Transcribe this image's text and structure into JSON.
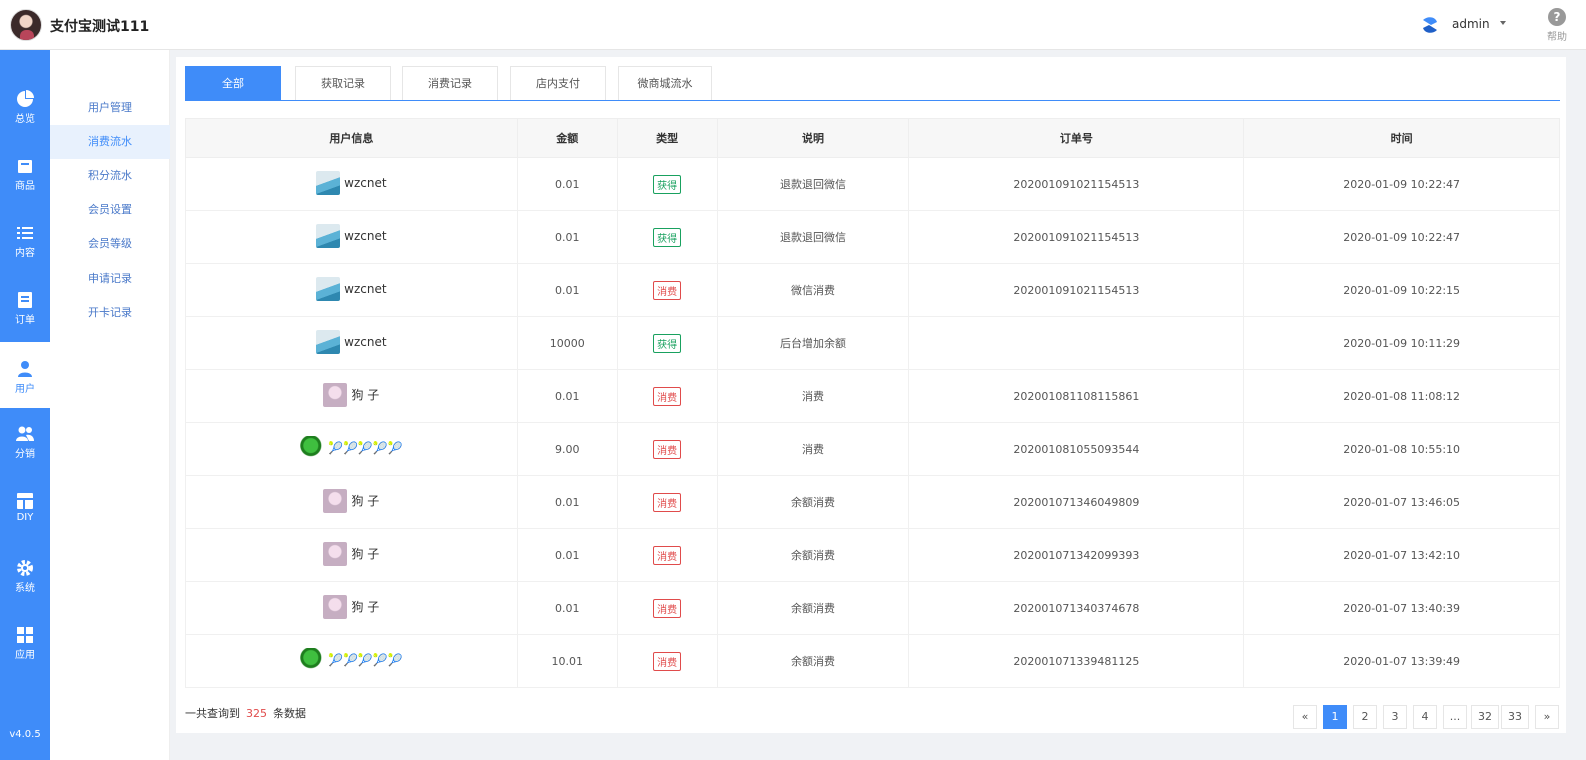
{
  "header": {
    "title": "支付宝测试111",
    "admin_name": "admin",
    "help_label": "帮助"
  },
  "nav": {
    "items": [
      {
        "label": "总览",
        "icon": "pie-chart-icon"
      },
      {
        "label": "商品",
        "icon": "shop-icon"
      },
      {
        "label": "内容",
        "icon": "list-icon"
      },
      {
        "label": "订单",
        "icon": "order-icon"
      },
      {
        "label": "用户",
        "icon": "user-icon"
      },
      {
        "label": "分销",
        "icon": "users-icon"
      },
      {
        "label": "DIY",
        "icon": "layout-icon"
      },
      {
        "label": "系统",
        "icon": "gear-icon"
      },
      {
        "label": "应用",
        "icon": "apps-icon"
      }
    ],
    "version": "v4.0.5"
  },
  "subnav": {
    "items": [
      "用户管理",
      "消费流水",
      "积分流水",
      "会员设置",
      "会员等级",
      "申请记录",
      "开卡记录"
    ]
  },
  "tabs": [
    "全部",
    "获取记录",
    "消费记录",
    "店内支付",
    "微商城流水"
  ],
  "table": {
    "headers": [
      "用户信息",
      "金额",
      "类型",
      "说明",
      "订单号",
      "时间"
    ],
    "rows": [
      {
        "user": "wzcnet",
        "amount": "0.01",
        "type": "获得",
        "desc": "退款退回微信",
        "order": "20200109102115451​3",
        "time": "2020-01-09 10:22:47"
      },
      {
        "user": "wzcnet",
        "amount": "0.01",
        "type": "获得",
        "desc": "退款退回微信",
        "order": "202001091021154513",
        "time": "2020-01-09 10:22:47"
      },
      {
        "user": "wzcnet",
        "amount": "0.01",
        "type": "消费",
        "desc": "微信消费",
        "order": "202001091021154513",
        "time": "2020-01-09 10:22:15"
      },
      {
        "user": "wzcnet",
        "amount": "10000",
        "type": "获得",
        "desc": "后台增加余额",
        "order": "",
        "time": "2020-01-09 10:11:29"
      },
      {
        "user": "狗 子",
        "amount": "0.01",
        "type": "消费",
        "desc": "消费",
        "order": "202001081108115861",
        "time": "2020-01-08 11:08:12"
      },
      {
        "user": "🎾🎾🎾🎾🎾",
        "amount": "9.00",
        "type": "消费",
        "desc": "消费",
        "order": "202001081055093544",
        "time": "2020-01-08 10:55:10"
      },
      {
        "user": "狗 子",
        "amount": "0.01",
        "type": "消费",
        "desc": "余额消费",
        "order": "202001071346049809",
        "time": "2020-01-07 13:46:05"
      },
      {
        "user": "狗 子",
        "amount": "0.01",
        "type": "消费",
        "desc": "余额消费",
        "order": "202001071342099393",
        "time": "2020-01-07 13:42:10"
      },
      {
        "user": "狗 子",
        "amount": "0.01",
        "type": "消费",
        "desc": "余额消费",
        "order": "202001071340374678",
        "time": "2020-01-07 13:40:39"
      },
      {
        "user": "🎾🎾🎾🎾🎾",
        "amount": "10.01",
        "type": "消费",
        "desc": "余额消费",
        "order": "202001071339481125",
        "time": "2020-01-07 13:39:49"
      }
    ]
  },
  "footer": {
    "total_prefix": "一共查询到",
    "total_count": "325",
    "total_suffix": "条数据"
  },
  "pagination": [
    "«",
    "1",
    "2",
    "3",
    "4",
    "...",
    "32",
    "33",
    "»"
  ],
  "colors": {
    "accent": "#3f8cf9",
    "gain": "#19a15f",
    "spend": "#e04b4b"
  }
}
